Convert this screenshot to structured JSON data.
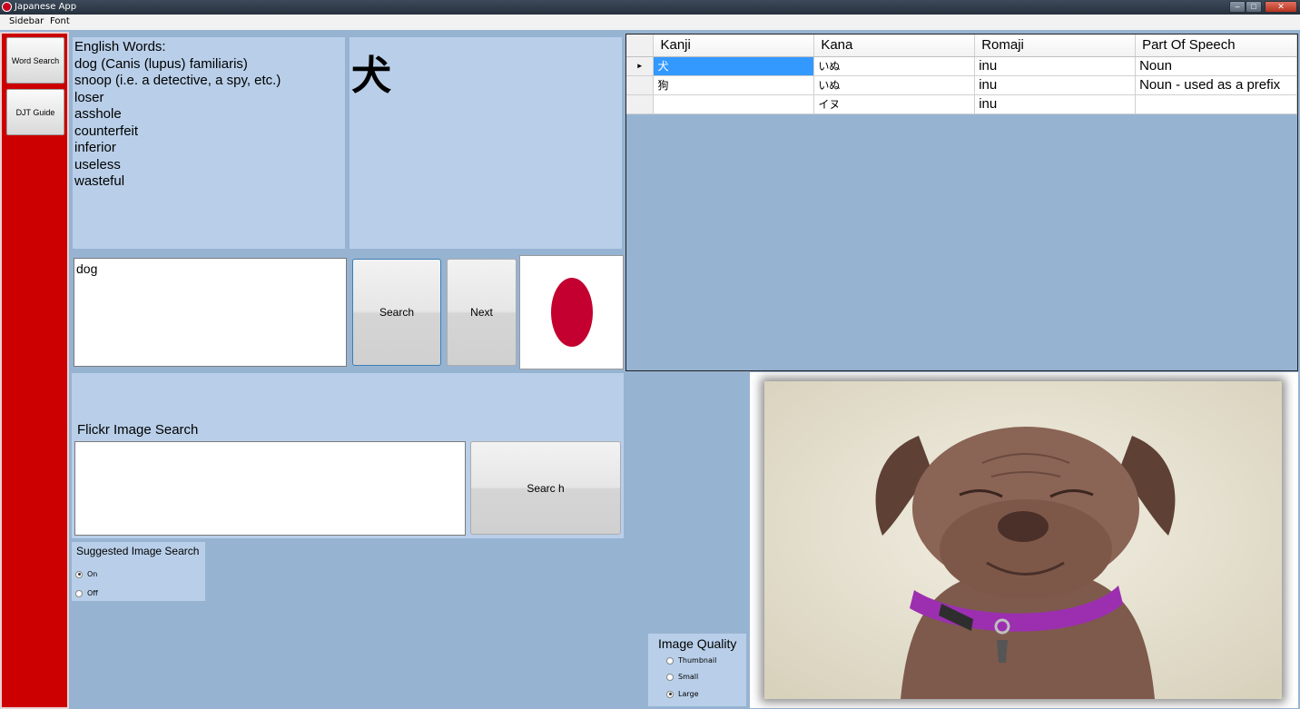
{
  "window": {
    "title": "Japanese App"
  },
  "menu": [
    "Sidebar",
    "Font"
  ],
  "sidebar": {
    "items": [
      "Word Search",
      "DJT Guide"
    ]
  },
  "english": {
    "title": "English Words:",
    "words": [
      "dog (Canis (lupus) familiaris)",
      "snoop (i.e. a detective, a spy, etc.)",
      "loser",
      "asshole",
      "counterfeit",
      "inferior",
      "useless",
      "wasteful"
    ]
  },
  "kanji_display": "犬",
  "search": {
    "value": "dog",
    "search_label": "Search",
    "next_label": "Next"
  },
  "results": {
    "columns": [
      "Kanji",
      "Kana",
      "Romaji",
      "Part Of Speech"
    ],
    "rows": [
      {
        "kanji": "犬",
        "kana": "いぬ",
        "romaji": "inu",
        "pos": "Noun"
      },
      {
        "kanji": "狗",
        "kana": "いぬ",
        "romaji": "inu",
        "pos": "Noun - used as a prefix"
      },
      {
        "kanji": "",
        "kana": "イヌ",
        "romaji": "inu",
        "pos": ""
      }
    ]
  },
  "flickr": {
    "label": "Flickr Image Search",
    "value": "",
    "button_label": "Searc h"
  },
  "suggested": {
    "title": "Suggested Image Search",
    "options": [
      "On",
      "Off"
    ],
    "selected": "On"
  },
  "quality": {
    "title": "Image Quality",
    "options": [
      "Thumbnail",
      "Small",
      "Large"
    ],
    "selected": "Large"
  },
  "colors": {
    "sidebar": "#cc0000",
    "panel": "#b9cfe9",
    "background": "#97b3d2",
    "flag_red": "#c3002f",
    "selection": "#3399ff"
  },
  "icons": {
    "app": "red-circle-icon",
    "flag": "japan-flag-icon",
    "photo": "dog-photo"
  }
}
